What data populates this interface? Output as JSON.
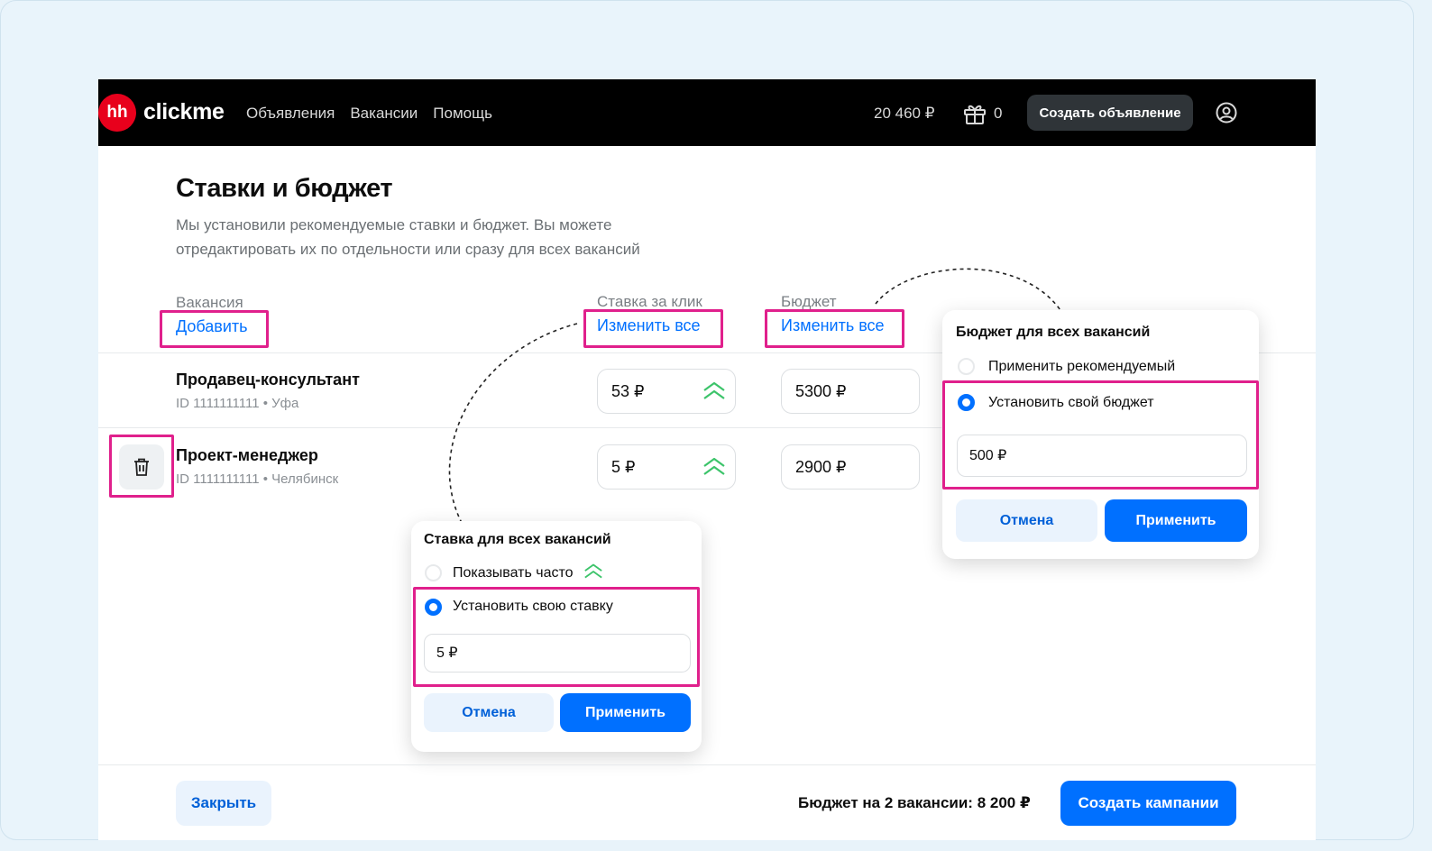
{
  "header": {
    "logo_badge": "hh",
    "logo_text": "clickme",
    "nav": [
      "Объявления",
      "Вакансии",
      "Помощь"
    ],
    "balance": "20 460 ₽",
    "gift_count": "0",
    "create_ad": "Создать объявление"
  },
  "page": {
    "title": "Ставки и бюджет",
    "subtitle": "Мы установили рекомендуемые ставки и бюджет. Вы можете отредактировать их по отдельности или сразу для всех вакансий"
  },
  "columns": {
    "vacancy": "Вакансия",
    "add_link": "Добавить",
    "bid": "Ставка за клик",
    "bid_change_all": "Изменить все",
    "budget": "Бюджет",
    "budget_change_all": "Изменить все"
  },
  "rows": [
    {
      "title": "Продавец-консультант",
      "meta": "ID 1111111111 • Уфа",
      "bid": "53 ₽",
      "budget": "5300 ₽"
    },
    {
      "title": "Проект-менеджер",
      "meta": "ID 1111111111 • Челябинск",
      "bid": "5 ₽",
      "budget": "2900 ₽"
    }
  ],
  "bid_popup": {
    "title": "Ставка для всех вакансий",
    "option_often": "Показывать часто",
    "option_custom": "Установить свою ставку",
    "value": "5 ₽",
    "cancel": "Отмена",
    "apply": "Применить"
  },
  "budget_popup": {
    "title": "Бюджет для всех вакансий",
    "option_recommended": "Применить рекомендуемый",
    "option_custom": "Установить свой бюджет",
    "value": "500 ₽",
    "cancel": "Отмена",
    "apply": "Применить"
  },
  "footer": {
    "close": "Закрыть",
    "budget_total": "Бюджет на 2 вакансии: 8 200 ₽",
    "create_campaigns": "Создать кампании"
  },
  "colors": {
    "accent": "#0070ff",
    "highlight": "#e0208c",
    "logo_red": "#e8001c",
    "chevron_green": "#3cc46a"
  }
}
